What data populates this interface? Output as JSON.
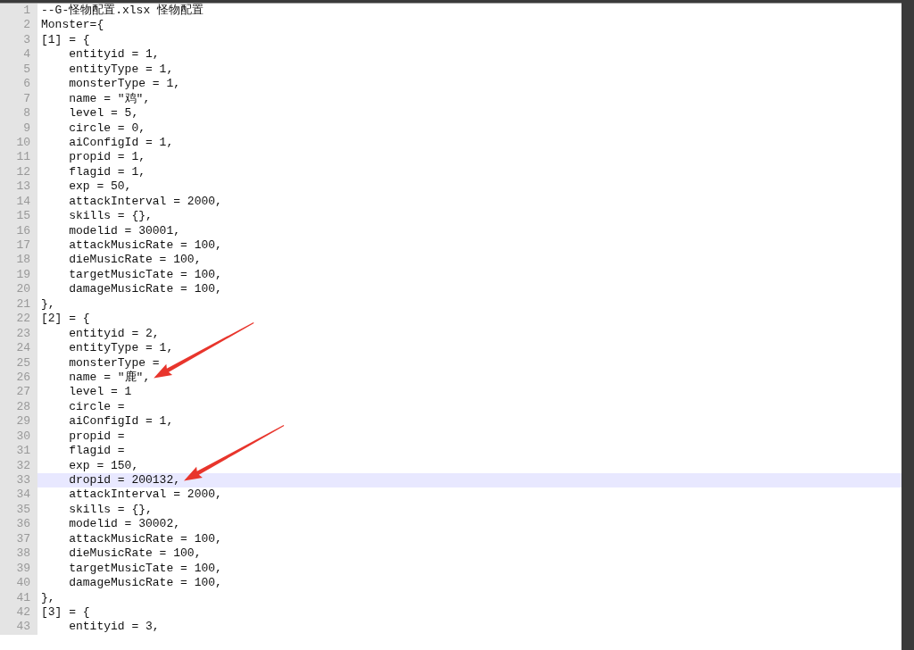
{
  "editor": {
    "lines": [
      {
        "n": "1",
        "text": "--G-怪物配置.xlsx 怪物配置",
        "highlighted": false
      },
      {
        "n": "2",
        "text": "Monster={",
        "highlighted": false
      },
      {
        "n": "3",
        "text": "[1] = {",
        "highlighted": false
      },
      {
        "n": "4",
        "text": "    entityid = 1,",
        "highlighted": false
      },
      {
        "n": "5",
        "text": "    entityType = 1,",
        "highlighted": false
      },
      {
        "n": "6",
        "text": "    monsterType = 1,",
        "highlighted": false
      },
      {
        "n": "7",
        "text": "    name = \"鸡\",",
        "highlighted": false
      },
      {
        "n": "8",
        "text": "    level = 5,",
        "highlighted": false
      },
      {
        "n": "9",
        "text": "    circle = 0,",
        "highlighted": false
      },
      {
        "n": "10",
        "text": "    aiConfigId = 1,",
        "highlighted": false
      },
      {
        "n": "11",
        "text": "    propid = 1,",
        "highlighted": false
      },
      {
        "n": "12",
        "text": "    flagid = 1,",
        "highlighted": false
      },
      {
        "n": "13",
        "text": "    exp = 50,",
        "highlighted": false
      },
      {
        "n": "14",
        "text": "    attackInterval = 2000,",
        "highlighted": false
      },
      {
        "n": "15",
        "text": "    skills = {},",
        "highlighted": false
      },
      {
        "n": "16",
        "text": "    modelid = 30001,",
        "highlighted": false
      },
      {
        "n": "17",
        "text": "    attackMusicRate = 100,",
        "highlighted": false
      },
      {
        "n": "18",
        "text": "    dieMusicRate = 100,",
        "highlighted": false
      },
      {
        "n": "19",
        "text": "    targetMusicTate = 100,",
        "highlighted": false
      },
      {
        "n": "20",
        "text": "    damageMusicRate = 100,",
        "highlighted": false
      },
      {
        "n": "21",
        "text": "},",
        "highlighted": false
      },
      {
        "n": "22",
        "text": "[2] = {",
        "highlighted": false
      },
      {
        "n": "23",
        "text": "    entityid = 2,",
        "highlighted": false
      },
      {
        "n": "24",
        "text": "    entityType = 1,",
        "highlighted": false
      },
      {
        "n": "25",
        "text": "    monsterType =",
        "highlighted": false
      },
      {
        "n": "26",
        "text": "    name = \"鹿\",",
        "highlighted": false,
        "arrow": true
      },
      {
        "n": "27",
        "text": "    level = 1",
        "highlighted": false
      },
      {
        "n": "28",
        "text": "    circle = ",
        "highlighted": false
      },
      {
        "n": "29",
        "text": "    aiConfigId = 1,",
        "highlighted": false
      },
      {
        "n": "30",
        "text": "    propid = ",
        "highlighted": false
      },
      {
        "n": "31",
        "text": "    flagid =",
        "highlighted": false
      },
      {
        "n": "32",
        "text": "    exp = 150,",
        "highlighted": false
      },
      {
        "n": "33",
        "text": "    dropid = 200132,",
        "highlighted": true,
        "arrow": true
      },
      {
        "n": "34",
        "text": "    attackInterval = 2000,",
        "highlighted": false
      },
      {
        "n": "35",
        "text": "    skills = {},",
        "highlighted": false
      },
      {
        "n": "36",
        "text": "    modelid = 30002,",
        "highlighted": false
      },
      {
        "n": "37",
        "text": "    attackMusicRate = 100,",
        "highlighted": false
      },
      {
        "n": "38",
        "text": "    dieMusicRate = 100,",
        "highlighted": false
      },
      {
        "n": "39",
        "text": "    targetMusicTate = 100,",
        "highlighted": false
      },
      {
        "n": "40",
        "text": "    damageMusicRate = 100,",
        "highlighted": false
      },
      {
        "n": "41",
        "text": "},",
        "highlighted": false
      },
      {
        "n": "42",
        "text": "[3] = {",
        "highlighted": false
      },
      {
        "n": "43",
        "text": "    entityid = 3,",
        "highlighted": false
      }
    ]
  }
}
